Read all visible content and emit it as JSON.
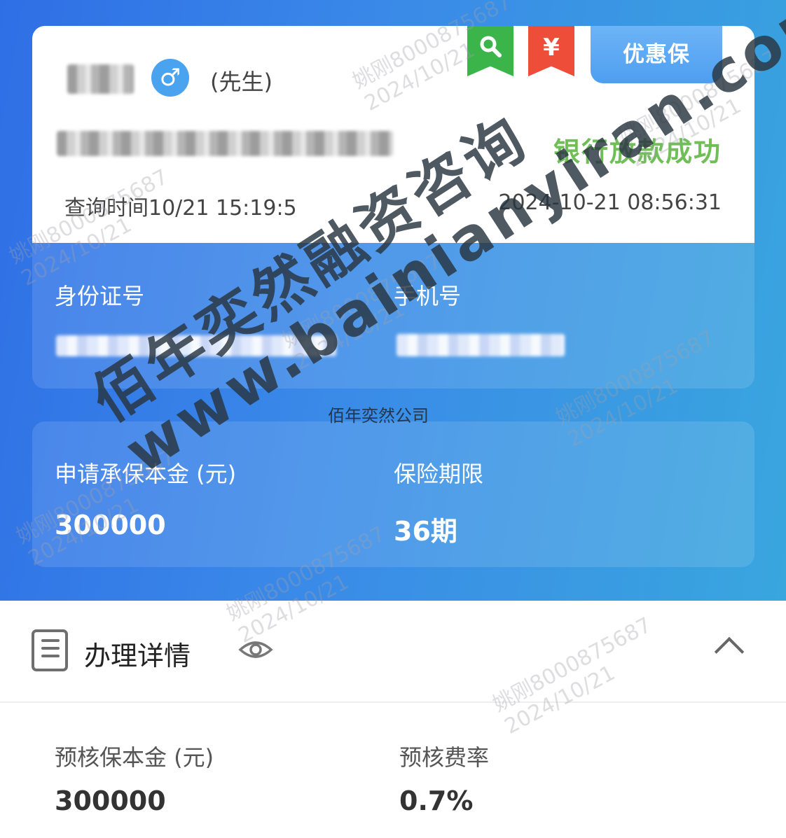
{
  "header": {
    "title_suffix": "(先生)",
    "gender_icon": "♂",
    "search_icon": "🔍",
    "yuan_icon": "¥",
    "promo_label": "优惠保",
    "status": "银行放款成功",
    "query_time": "查询时间10/21 15:19:5",
    "issue_time": "2024-10-21 08:56:31"
  },
  "identity": {
    "id_label": "身份证号",
    "phone_label": "手机号"
  },
  "application": {
    "principal_label": "申请承保本金 (元)",
    "principal_value": "300000",
    "term_label": "保险期限",
    "term_value": "36期"
  },
  "details": {
    "title": "办理详情",
    "precheck_principal_label": "预核保本金 (元)",
    "precheck_principal_value": "300000",
    "precheck_rate_label": "预核费率",
    "precheck_rate_value": "0.7%"
  },
  "watermark": {
    "line1": "佰年奕然融资咨询",
    "line2": "www.bainianyiran.com",
    "company": "佰年奕然公司",
    "small_name": "姚刚8000875687",
    "small_date": "2024/10/21"
  },
  "colors": {
    "accent": "#3a8ae8",
    "status_green": "#6fbe58",
    "search_ribbon": "#3bb54a",
    "yuan_ribbon": "#ee4d3a"
  }
}
